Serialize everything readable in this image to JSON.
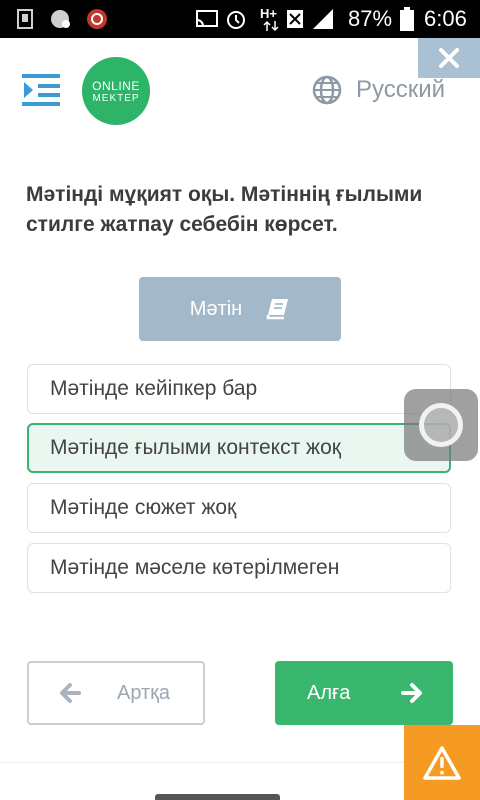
{
  "status_bar": {
    "network_type": "H+",
    "battery_percent": "87%",
    "time": "6:06"
  },
  "header": {
    "menu_icon": "menu-collapse-icon",
    "logo_line1": "ONLINE",
    "logo_line2": "MEKTEP",
    "language": "Русский",
    "close_icon": "close-icon"
  },
  "question": {
    "text": "Мәтінді мұқият оқы. Мәтіннің ғылыми стилге жатпау себебін көрсет."
  },
  "text_button": {
    "label": "Мәтін",
    "icon": "book-icon"
  },
  "options": [
    {
      "label": "Мәтінде кейіпкер бар",
      "selected": false
    },
    {
      "label": "Мәтінде ғылыми контекст жоқ",
      "selected": true
    },
    {
      "label": "Мәтінде сюжет жоқ",
      "selected": false
    },
    {
      "label": "Мәтінде мәселе көтерілмеген",
      "selected": false
    }
  ],
  "navigation": {
    "back_label": "Артқа",
    "next_label": "Алға"
  },
  "colors": {
    "brand_green": "#3ab76e",
    "selected_border": "#38b371",
    "warning": "#f59a23",
    "close_bg": "#a9c1d3"
  }
}
